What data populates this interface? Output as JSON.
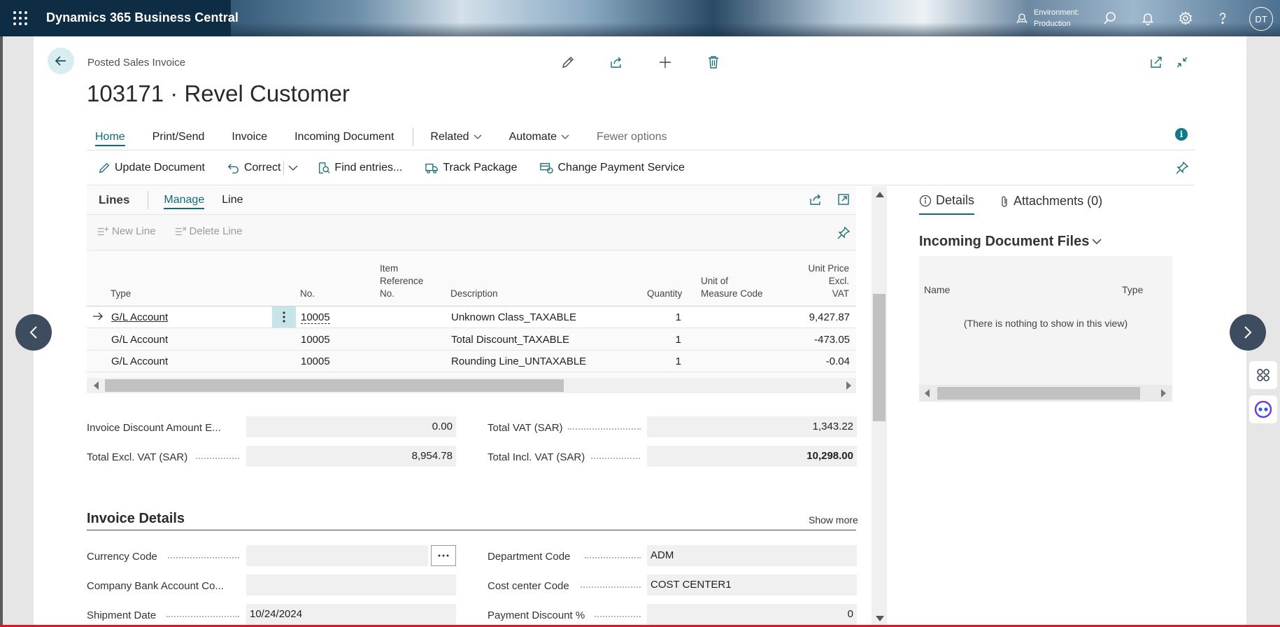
{
  "app": {
    "title": "Dynamics 365 Business Central",
    "environment_label": "Environment:",
    "environment_value": "Production",
    "user_initials": "DT"
  },
  "page": {
    "caption": "Posted Sales Invoice",
    "title": "103171 · Revel Customer"
  },
  "action_tabs": [
    "Home",
    "Print/Send",
    "Invoice",
    "Incoming Document",
    "Related",
    "Automate",
    "Fewer options"
  ],
  "actions": [
    "Update Document",
    "Correct",
    "Find entries...",
    "Track Package",
    "Change Payment Service"
  ],
  "lines": {
    "title": "Lines",
    "tabs": [
      "Manage",
      "Line"
    ],
    "actions": [
      "New Line",
      "Delete Line"
    ],
    "columns": {
      "type": "Type",
      "no": "No.",
      "item_ref_1": "Item",
      "item_ref_2": "Reference",
      "item_ref_3": "No.",
      "description": "Description",
      "quantity": "Quantity",
      "uom_1": "Unit of",
      "uom_2": "Measure Code",
      "price_1": "Unit Price Excl.",
      "price_2": "VAT"
    },
    "rows": [
      {
        "type": "G/L Account",
        "no": "10005",
        "description": "Unknown Class_TAXABLE",
        "quantity": "1",
        "unit_price": "9,427.87"
      },
      {
        "type": "G/L Account",
        "no": "10005",
        "description": "Total Discount_TAXABLE",
        "quantity": "1",
        "unit_price": "-473.05"
      },
      {
        "type": "G/L Account",
        "no": "10005",
        "description": "Rounding Line_UNTAXABLE",
        "quantity": "1",
        "unit_price": "-0.04"
      }
    ]
  },
  "totals": {
    "inv_disc_label": "Invoice Discount Amount E...",
    "inv_disc_value": "0.00",
    "total_excl_label": "Total Excl. VAT (SAR)",
    "total_excl_value": "8,954.78",
    "total_vat_label": "Total VAT (SAR)",
    "total_vat_value": "1,343.22",
    "total_incl_label": "Total Incl. VAT (SAR)",
    "total_incl_value": "10,298.00"
  },
  "invoice_details": {
    "title": "Invoice Details",
    "show_more": "Show more",
    "currency_code_label": "Currency Code",
    "currency_code_value": "",
    "company_bank_label": "Company Bank Account Co...",
    "company_bank_value": "",
    "shipment_date_label": "Shipment Date",
    "shipment_date_value": "10/24/2024",
    "department_code_label": "Department Code",
    "department_code_value": "ADM",
    "cost_center_label": "Cost center Code",
    "cost_center_value": "COST CENTER1",
    "payment_discount_label": "Payment Discount %",
    "payment_discount_value": "0"
  },
  "factbox": {
    "tab_details": "Details",
    "tab_attachments": "Attachments (0)",
    "title": "Incoming Document Files",
    "col_name": "Name",
    "col_type": "Type",
    "empty_text": "(There is nothing to show in this view)"
  },
  "colors": {
    "accent": "#0f6b7b",
    "appbar": "#0f2c45",
    "nav_circle": "#3e4c5f"
  }
}
